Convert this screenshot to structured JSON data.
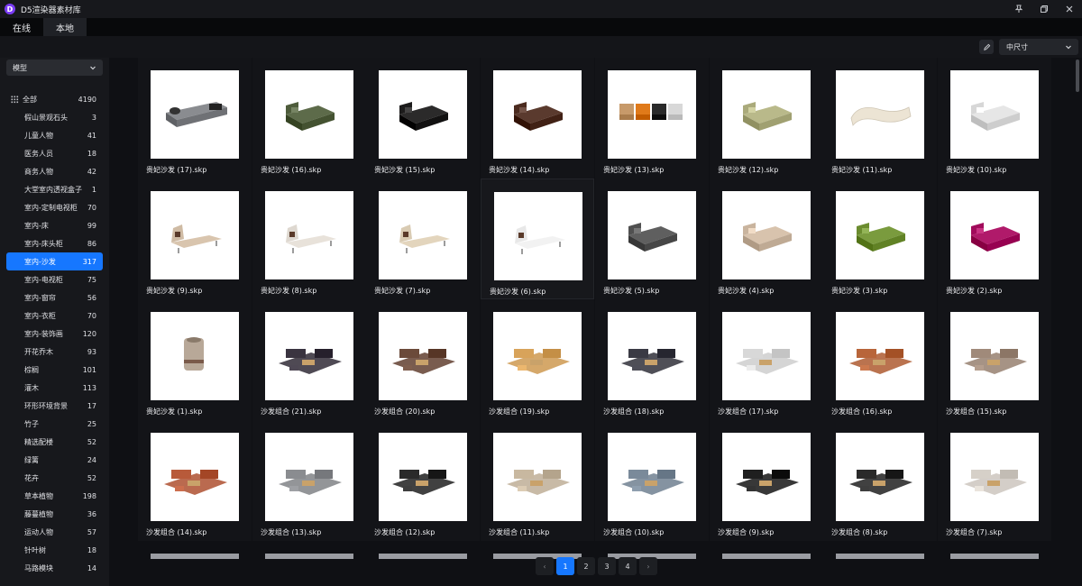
{
  "app": {
    "title": "D5渲染器素材库",
    "logo_letter": "D"
  },
  "window": {
    "pin_icon": "pin-icon",
    "restore_icon": "restore-icon",
    "close_icon": "close-icon"
  },
  "tabs": [
    {
      "label": "在线"
    },
    {
      "label": "本地",
      "active": true
    }
  ],
  "toolbar": {
    "size_select": "中尺寸"
  },
  "sidebar": {
    "type_select": "模型",
    "categories": [
      {
        "label": "全部",
        "count": "4190"
      },
      {
        "label": "假山景观石头",
        "count": "3"
      },
      {
        "label": "儿童人物",
        "count": "41"
      },
      {
        "label": "医务人员",
        "count": "18"
      },
      {
        "label": "商务人物",
        "count": "42"
      },
      {
        "label": "大堂室内透视盒子",
        "count": "1"
      },
      {
        "label": "室内-定制电视柜",
        "count": "70"
      },
      {
        "label": "室内-床",
        "count": "99"
      },
      {
        "label": "室内-床头柜",
        "count": "86"
      },
      {
        "label": "室内-沙发",
        "count": "317",
        "active": true
      },
      {
        "label": "室内-电视柜",
        "count": "75"
      },
      {
        "label": "室内-窗帘",
        "count": "56"
      },
      {
        "label": "室内-衣柜",
        "count": "70"
      },
      {
        "label": "室内-装饰画",
        "count": "120"
      },
      {
        "label": "开花乔木",
        "count": "93"
      },
      {
        "label": "棕榈",
        "count": "101"
      },
      {
        "label": "灌木",
        "count": "113"
      },
      {
        "label": "环形环境背景",
        "count": "17"
      },
      {
        "label": "竹子",
        "count": "25"
      },
      {
        "label": "精选配楼",
        "count": "52"
      },
      {
        "label": "绿篱",
        "count": "24"
      },
      {
        "label": "花卉",
        "count": "52"
      },
      {
        "label": "草本植物",
        "count": "198"
      },
      {
        "label": "藤蔓植物",
        "count": "36"
      },
      {
        "label": "运动人物",
        "count": "57"
      },
      {
        "label": "针叶树",
        "count": "18"
      },
      {
        "label": "马路模块",
        "count": "14"
      }
    ]
  },
  "assets": [
    {
      "name": "贵妃沙发 (17).skp",
      "color": "#8a8c90",
      "kind": "sofa"
    },
    {
      "name": "贵妃沙发 (16).skp",
      "color": "#5d6b4a",
      "kind": "chaise"
    },
    {
      "name": "贵妃沙发 (15).skp",
      "color": "#2b2a2a",
      "kind": "chaise"
    },
    {
      "name": "贵妃沙发 (14).skp",
      "color": "#5a3a2e",
      "kind": "chaise"
    },
    {
      "name": "贵妃沙发 (13).skp",
      "color": "#c8893a",
      "kind": "multi"
    },
    {
      "name": "贵妃沙发 (12).skp",
      "color": "#b9b98a",
      "kind": "chaise"
    },
    {
      "name": "贵妃沙发 (11).skp",
      "color": "#ece4d4",
      "kind": "curve"
    },
    {
      "name": "贵妃沙发 (10).skp",
      "color": "#e6e6e6",
      "kind": "chaise"
    },
    {
      "name": "贵妃沙发 (9).skp",
      "color": "#d9c5ae",
      "kind": "lounge"
    },
    {
      "name": "贵妃沙发 (8).skp",
      "color": "#e8e2da",
      "kind": "lounge"
    },
    {
      "name": "贵妃沙发 (7).skp",
      "color": "#e3d5bd",
      "kind": "lounge"
    },
    {
      "name": "贵妃沙发 (6).skp",
      "color": "#f2f2f2",
      "kind": "lounge"
    },
    {
      "name": "贵妃沙发 (5).skp",
      "color": "#5f5f5f",
      "kind": "chaise"
    },
    {
      "name": "贵妃沙发 (4).skp",
      "color": "#d8c3ad",
      "kind": "chaise"
    },
    {
      "name": "贵妃沙发 (3).skp",
      "color": "#7a9b3e",
      "kind": "chaise"
    },
    {
      "name": "贵妃沙发 (2).skp",
      "color": "#b01a6a",
      "kind": "chaise"
    },
    {
      "name": "贵妃沙发 (1).skp",
      "color": "#b8a898",
      "kind": "single"
    },
    {
      "name": "沙发组合 (21).skp",
      "color": "#3a3440",
      "kind": "set"
    },
    {
      "name": "沙发组合 (20).skp",
      "color": "#6b4a3a",
      "kind": "set"
    },
    {
      "name": "沙发组合 (19).skp",
      "color": "#d8a35a",
      "kind": "set"
    },
    {
      "name": "沙发组合 (18).skp",
      "color": "#3a3a44",
      "kind": "set"
    },
    {
      "name": "沙发组合 (17).skp",
      "color": "#d8d8d8",
      "kind": "set"
    },
    {
      "name": "沙发组合 (16).skp",
      "color": "#b8653a",
      "kind": "set"
    },
    {
      "name": "沙发组合 (15).skp",
      "color": "#a08a7a",
      "kind": "set"
    },
    {
      "name": "沙发组合 (14).skp",
      "color": "#b85a3a",
      "kind": "set"
    },
    {
      "name": "沙发组合 (13).skp",
      "color": "#8a8c90",
      "kind": "set"
    },
    {
      "name": "沙发组合 (12).skp",
      "color": "#2a2a2a",
      "kind": "set"
    },
    {
      "name": "沙发组合 (11).skp",
      "color": "#c8b8a0",
      "kind": "set"
    },
    {
      "name": "沙发组合 (10).skp",
      "color": "#7a8a9a",
      "kind": "set"
    },
    {
      "name": "沙发组合 (9).skp",
      "color": "#1f1f1f",
      "kind": "set"
    },
    {
      "name": "沙发组合 (8).skp",
      "color": "#2a2a2a",
      "kind": "set"
    },
    {
      "name": "沙发组合 (7).skp",
      "color": "#d6d0c8",
      "kind": "set"
    }
  ],
  "pagination": {
    "prev": "‹",
    "next": "›",
    "pages": [
      "1",
      "2",
      "3",
      "4"
    ],
    "current": "1"
  }
}
